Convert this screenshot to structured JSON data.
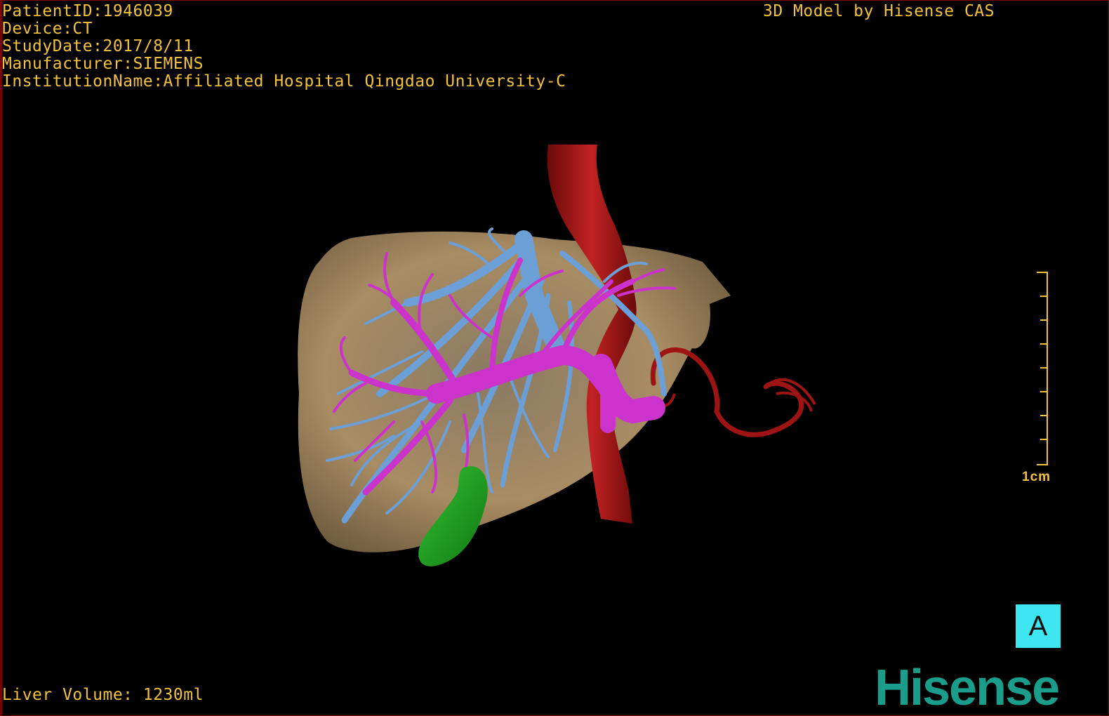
{
  "viewer": {
    "meta": {
      "patient_id": "PatientID:1946039",
      "device": "Device:CT",
      "study_date": "StudyDate:2017/8/11",
      "manufacturer": "Manufacturer:SIEMENS",
      "institution": "InstitutionName:Affiliated Hospital Qingdao University-C"
    },
    "brand_title": "3D Model by Hisense CAS",
    "liver_volume": "Liver Volume: 1230ml",
    "scale_label": "1cm",
    "orientation_label": "A",
    "logo_text": "Hisense"
  },
  "colors": {
    "text": "#f2c23a",
    "liver": "#a88c63",
    "hepatic_vein": "#6b9fd6",
    "portal_vein": "#cc33cc",
    "artery": "#9e1414",
    "gallbladder": "#1c9e1c",
    "orientation_box": "#3ee6f2",
    "logo": "#1a9d8a"
  }
}
